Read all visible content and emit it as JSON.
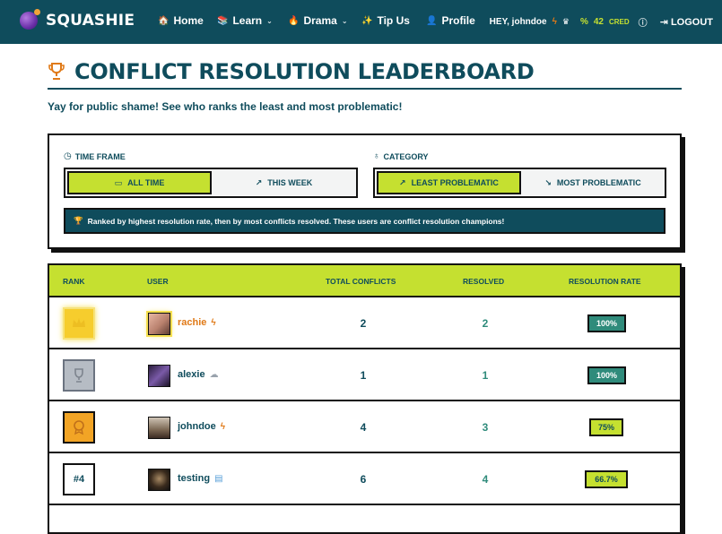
{
  "nav": {
    "brand": "SQUASHIE",
    "items": [
      {
        "label": "Home",
        "icon": "home-icon",
        "glyph": "🏠",
        "dropdown": false
      },
      {
        "label": "Learn",
        "icon": "book-icon",
        "glyph": "📚",
        "dropdown": true
      },
      {
        "label": "Drama",
        "icon": "fire-icon",
        "glyph": "🔥",
        "dropdown": true
      },
      {
        "label": "Tip Us",
        "icon": "sparkle-icon",
        "glyph": "✨",
        "dropdown": false
      },
      {
        "label": "Profile",
        "icon": "person-icon",
        "glyph": "👤",
        "dropdown": false
      }
    ],
    "greeting": "HEY, johndoe",
    "cred_value": "42",
    "cred_label": "CRED",
    "logout": "LOGOUT"
  },
  "page": {
    "title": "CONFLICT RESOLUTION LEADERBOARD",
    "subtitle": "Yay for public shame! See who ranks the least and most problematic!"
  },
  "filters": {
    "time_frame_label": "TIME FRAME",
    "time_options": [
      {
        "label": "ALL TIME",
        "active": true
      },
      {
        "label": "THIS WEEK",
        "active": false
      }
    ],
    "category_label": "CATEGORY",
    "category_options": [
      {
        "label": "LEAST PROBLEMATIC",
        "active": true
      },
      {
        "label": "MOST PROBLEMATIC",
        "active": false
      }
    ],
    "info": "Ranked by highest resolution rate, then by most conflicts resolved. These users are conflict resolution champions!"
  },
  "table": {
    "headers": {
      "rank": "RANK",
      "user": "USER",
      "total": "TOTAL CONFLICTS",
      "resolved": "RESOLVED",
      "rate": "RESOLUTION RATE"
    },
    "rows": [
      {
        "rank": "1",
        "rank_style": "gold",
        "user": "rachie",
        "user_badge": "lightning-icon",
        "total": "2",
        "resolved": "2",
        "rate": "100%"
      },
      {
        "rank": "2",
        "rank_style": "silver",
        "user": "alexie",
        "user_badge": "cloud-icon",
        "total": "1",
        "resolved": "1",
        "rate": "100%"
      },
      {
        "rank": "3",
        "rank_style": "bronze",
        "user": "johndoe",
        "user_badge": "lightning-icon",
        "total": "4",
        "resolved": "3",
        "rate": "75%"
      },
      {
        "rank": "#4",
        "rank_style": "number",
        "user": "testing",
        "user_badge": "cards-icon",
        "total": "6",
        "resolved": "4",
        "rate": "66.7%"
      }
    ]
  },
  "colors": {
    "navy": "#0f4c5c",
    "lime": "#c5e030",
    "teal": "#2f8b7b",
    "orange": "#e07a18"
  }
}
